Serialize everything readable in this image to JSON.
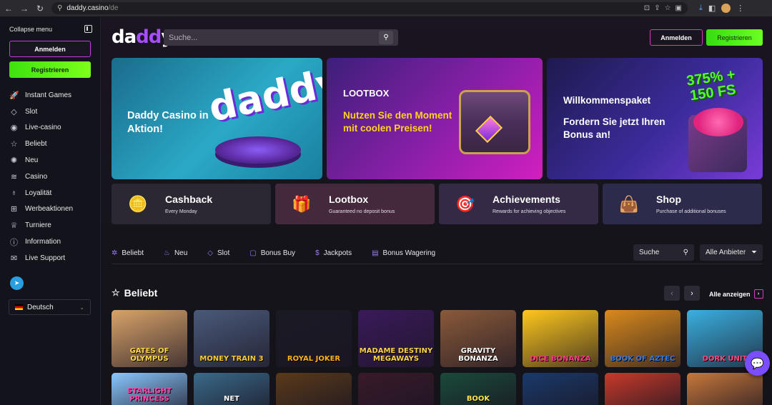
{
  "browser": {
    "url_host": "daddy.casino",
    "url_path": "/de"
  },
  "sidebar": {
    "collapse_label": "Collapse menu",
    "login_label": "Anmelden",
    "register_label": "Registrieren",
    "items": [
      {
        "label": "Instant Games",
        "icon": "rocket-icon"
      },
      {
        "label": "Slot",
        "icon": "diamond-icon"
      },
      {
        "label": "Live-casino",
        "icon": "live-icon"
      },
      {
        "label": "Beliebt",
        "icon": "star-icon"
      },
      {
        "label": "Neu",
        "icon": "new-icon"
      },
      {
        "label": "Casino",
        "icon": "chips-icon"
      },
      {
        "label": "Loyalität",
        "icon": "medal-icon"
      },
      {
        "label": "Werbeaktionen",
        "icon": "gift-icon"
      },
      {
        "label": "Turniere",
        "icon": "trophy-icon"
      },
      {
        "label": "Information",
        "icon": "info-icon"
      },
      {
        "label": "Live Support",
        "icon": "chat-icon"
      }
    ],
    "language": "Deutsch"
  },
  "header": {
    "logo_text_a": "da",
    "logo_text_b": "dd",
    "logo_text_c": "y",
    "search_placeholder": "Suche...",
    "login_label": "Anmelden",
    "register_label": "Registrieren"
  },
  "banners": [
    {
      "title": "Daddy Casino in Aktion!",
      "art_text": "daddy"
    },
    {
      "title": "LOOTBOX",
      "subtitle": "Nutzen Sie den Moment mit coolen Preisen!"
    },
    {
      "title": "Willkommenspaket",
      "subtitle": "Fordern Sie jetzt Ihren Bonus an!",
      "badge": "375% + 150 FS"
    }
  ],
  "features": [
    {
      "title": "Cashback",
      "subtitle": "Every Monday"
    },
    {
      "title": "Lootbox",
      "subtitle": "Guaranteed no deposit bonus"
    },
    {
      "title": "Achievements",
      "subtitle": "Rewards for achieving objectives"
    },
    {
      "title": "Shop",
      "subtitle": "Purchase of additional bonuses"
    }
  ],
  "categories": [
    "Beliebt",
    "Neu",
    "Slot",
    "Bonus Buy",
    "Jackpots",
    "Bonus Wagering"
  ],
  "filters": {
    "search_label": "Suche",
    "provider_label": "Alle Anbieter"
  },
  "section": {
    "title": "Beliebt",
    "show_all": "Alle anzeigen"
  },
  "games_row1": [
    {
      "name": "Gates of Olympus",
      "bg": "#d9a36a",
      "fg": "#ffd84a"
    },
    {
      "name": "Money Train 3",
      "bg": "#4a5a7a",
      "fg": "#ffcc33"
    },
    {
      "name": "Royal Joker",
      "bg": "#1a1a24",
      "fg": "#ffb21c"
    },
    {
      "name": "Madame Destiny Megaways",
      "bg": "#3a1a5a",
      "fg": "#ffd24a"
    },
    {
      "name": "Gravity Bonanza",
      "bg": "#8a5a3a",
      "fg": "#ffffff"
    },
    {
      "name": "Dice Bonanza",
      "bg": "#ffc81c",
      "fg": "#ff3a8a"
    },
    {
      "name": "Book of Aztec",
      "bg": "#d98a1c",
      "fg": "#3a7ad9"
    },
    {
      "name": "Dork Unit",
      "bg": "#3ab0e0",
      "fg": "#ff4a7a"
    }
  ],
  "games_row2": [
    {
      "name": "Starlight Princess",
      "bg": "#8ac8ff",
      "fg": "#ff4ab0"
    },
    {
      "name": "Net",
      "bg": "#3a6a8a",
      "fg": "#ffffff"
    },
    {
      "name": "",
      "bg": "#5a3a1a",
      "fg": "#ffffff"
    },
    {
      "name": "",
      "bg": "#3a1a2a",
      "fg": "#ffffff"
    },
    {
      "name": "Book",
      "bg": "#1a4a3a",
      "fg": "#ffe84a"
    },
    {
      "name": "",
      "bg": "#1a3a6a",
      "fg": "#ffffff"
    },
    {
      "name": "",
      "bg": "#c83a2a",
      "fg": "#ffffff"
    },
    {
      "name": "",
      "bg": "#c8783a",
      "fg": "#ffffff"
    }
  ]
}
